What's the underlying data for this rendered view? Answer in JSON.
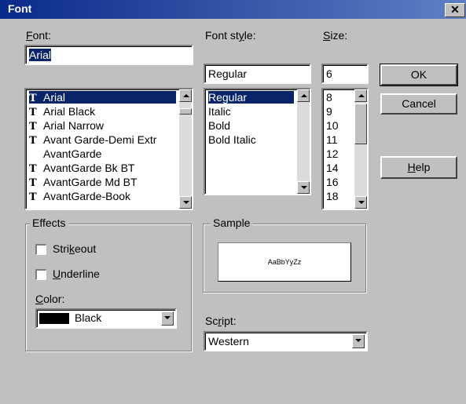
{
  "window": {
    "title": "Font",
    "close_glyph": "✕"
  },
  "font": {
    "label_mnemonic": "F",
    "label_rest": "ont:",
    "value": "Arial",
    "items": [
      {
        "name": "Arial",
        "icon": "truetype-icon"
      },
      {
        "name": "Arial Black",
        "icon": "truetype-icon"
      },
      {
        "name": "Arial Narrow",
        "icon": "truetype-icon"
      },
      {
        "name": "Avant Garde-Demi Extr",
        "icon": "truetype-icon"
      },
      {
        "name": "AvantGarde",
        "icon": ""
      },
      {
        "name": "AvantGarde Bk BT",
        "icon": "truetype-icon"
      },
      {
        "name": "AvantGarde Md BT",
        "icon": "truetype-icon"
      },
      {
        "name": "AvantGarde-Book",
        "icon": "truetype-icon"
      }
    ],
    "selected_index": 0
  },
  "style": {
    "label_pre": "Font st",
    "label_mnemonic": "y",
    "label_post": "le:",
    "value": "Regular",
    "items": [
      "Regular",
      "Italic",
      "Bold",
      "Bold Italic"
    ],
    "selected_index": 0
  },
  "size": {
    "label_mnemonic": "S",
    "label_rest": "ize:",
    "value": "6",
    "items": [
      "8",
      "9",
      "10",
      "11",
      "12",
      "14",
      "16",
      "18"
    ]
  },
  "buttons": {
    "ok": "OK",
    "cancel": "Cancel",
    "help_mnemonic": "H",
    "help_rest": "elp"
  },
  "effects": {
    "title": "Effects",
    "strikeout_pre": "Stri",
    "strikeout_mnemonic": "k",
    "strikeout_post": "eout",
    "strikeout_checked": false,
    "underline_mnemonic": "U",
    "underline_rest": "nderline",
    "underline_checked": false,
    "color_mnemonic": "C",
    "color_rest": "olor:",
    "color_value": "Black",
    "color_swatch": "#000000"
  },
  "sample": {
    "title": "Sample",
    "text": "AaBbYyZz"
  },
  "script": {
    "label_pre": "Sc",
    "label_mnemonic": "r",
    "label_post": "ipt:",
    "value": "Western"
  },
  "colors": {
    "selection": "#0a246a",
    "face": "#c0c0c0"
  }
}
